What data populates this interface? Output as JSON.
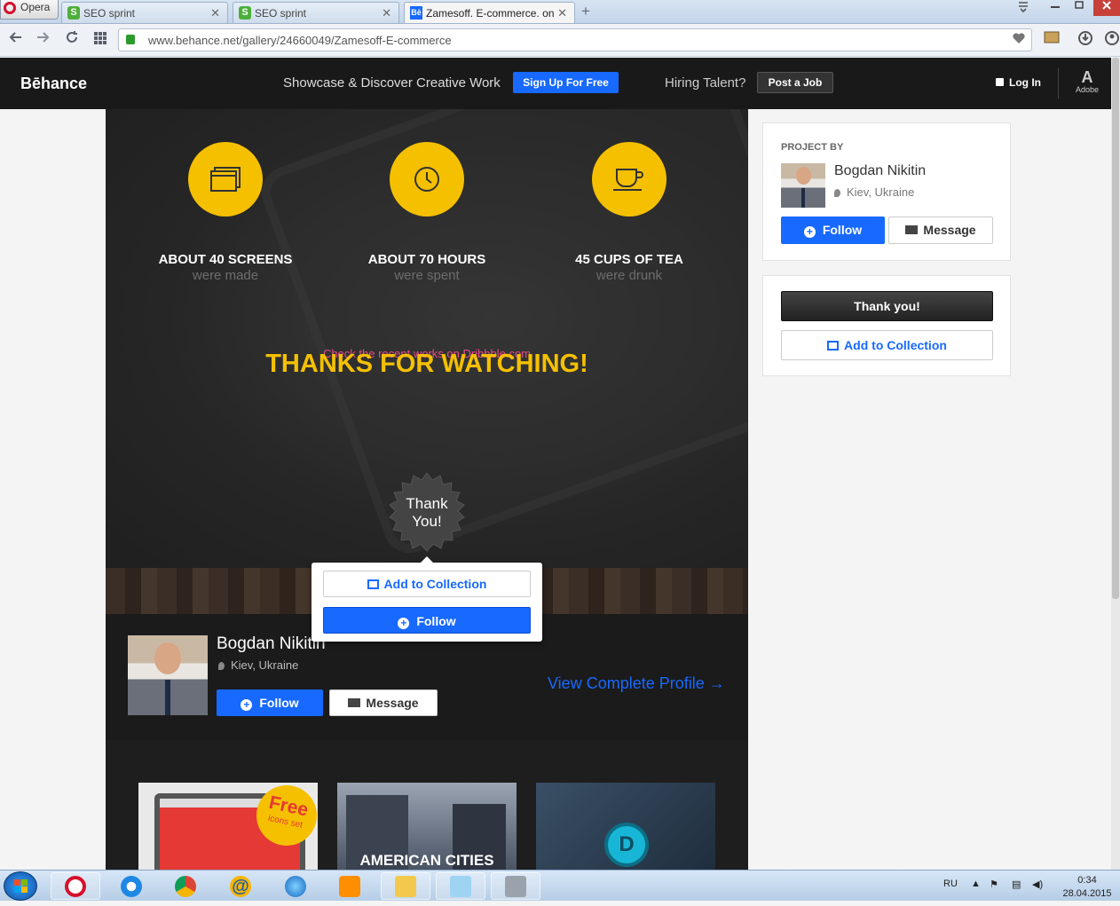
{
  "browser": {
    "menu_label": "Opera",
    "tabs": [
      {
        "title": "SEO sprint",
        "favicon": "S"
      },
      {
        "title": "SEO sprint",
        "favicon": "S"
      },
      {
        "title": "Zamesoff. E-commerce. on",
        "favicon": "Bē"
      }
    ],
    "close_glyph": "✕",
    "new_tab_glyph": "+",
    "url": "www.behance.net/gallery/24660049/Zamesoff-E-commerce"
  },
  "header": {
    "logo": "Bēhance",
    "tagline": "Showcase & Discover Creative Work",
    "signup_label": "Sign Up For Free",
    "hiring_text": "Hiring Talent?",
    "post_job_label": "Post a Job",
    "login_label": "Log In",
    "adobe_mark": "A",
    "adobe_label": "Adobe"
  },
  "project": {
    "stats": [
      {
        "title": "ABOUT 40 SCREENS",
        "sub": "were made",
        "icon": "windows-icon"
      },
      {
        "title": "ABOUT 70 HOURS",
        "sub": "were spent",
        "icon": "clock-icon"
      },
      {
        "title": "45 CUPS OF TEA",
        "sub": "were drunk",
        "icon": "cup-icon"
      }
    ],
    "dribbble_text": "Check the recent works on Dribbble.com",
    "thanks_text": "THANKS FOR WATCHING!",
    "badge_line1": "Thank",
    "badge_line2": "You!"
  },
  "popup": {
    "add_collection_label": "Add to Collection",
    "follow_label": "Follow"
  },
  "owner": {
    "name": "Bogdan Nikitin",
    "location": "Kiev, Ukraine",
    "follow_label": "Follow",
    "message_label": "Message",
    "view_profile_label": "View Complete Profile →"
  },
  "gallery": {
    "thumbs": [
      {
        "caption": "Free",
        "sub": "icons set"
      },
      {
        "caption": "AMERICAN CITIES"
      },
      {
        "caption": "D"
      }
    ]
  },
  "sidebar": {
    "project_by_label": "PROJECT BY",
    "name": "Bogdan Nikitin",
    "location": "Kiev, Ukraine",
    "follow_label": "Follow",
    "message_label": "Message",
    "thank_label": "Thank you!",
    "add_collection_label": "Add to Collection"
  },
  "taskbar": {
    "lang": "RU",
    "time": "0:34",
    "date": "28.04.2015"
  },
  "colors": {
    "behance_blue": "#1769ff",
    "accent_yellow": "#f5c000",
    "dark_bg": "#1e1e1e"
  }
}
